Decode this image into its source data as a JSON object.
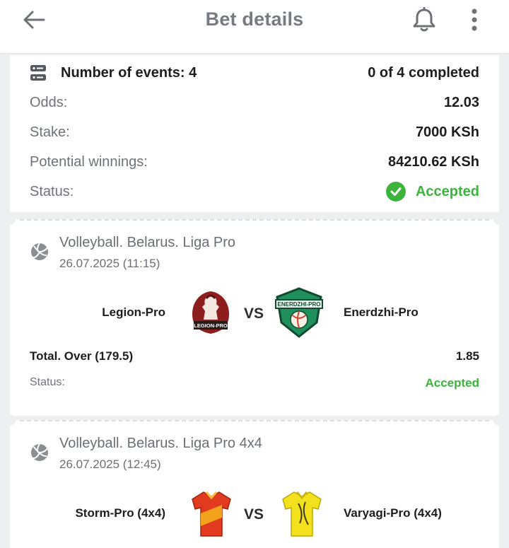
{
  "header": {
    "title": "Bet details",
    "back_icon": "arrow-left-icon",
    "notification_icon": "bell-icon",
    "menu_icon": "more-vertical-icon"
  },
  "summary": {
    "events_label": "Number of events: 4",
    "completed": "0 of 4 completed",
    "odds_label": "Odds:",
    "odds_value": "12.03",
    "stake_label": "Stake:",
    "stake_value": "7000 KSh",
    "winnings_label": "Potential winnings:",
    "winnings_value": "84210.62 KSh",
    "status_label": "Status:",
    "status_value": "Accepted"
  },
  "events": [
    {
      "league": "Volleyball. Belarus. Liga Pro",
      "datetime": "26.07.2025 (11:15)",
      "home_team": "Legion-Pro",
      "away_team": "Enerdzhi-Pro",
      "home_logo_text": "LEGION-PRO",
      "away_logo_text": "ENERDZHI-PRO",
      "vs": "VS",
      "bet": "Total. Over (179.5)",
      "bet_odds": "1.85",
      "status_label": "Status:",
      "status_value": "Accepted"
    },
    {
      "league": "Volleyball. Belarus. Liga Pro 4x4",
      "datetime": "26.07.2025 (12:45)",
      "home_team": "Storm-Pro (4x4)",
      "away_team": "Varyagi-Pro (4x4)",
      "vs": "VS"
    }
  ],
  "colors": {
    "accent_green": "#3cb43c",
    "background": "#eeeff1",
    "header_text": "#777a80"
  }
}
